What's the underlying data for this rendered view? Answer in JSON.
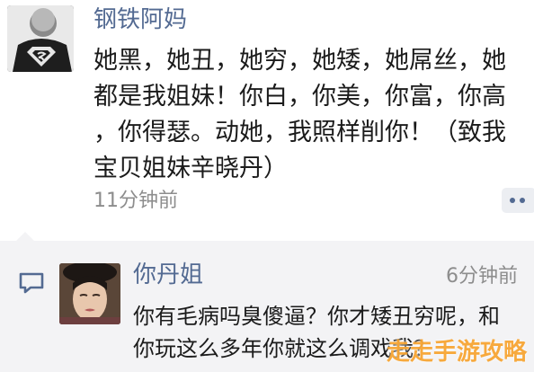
{
  "post": {
    "author": "钢铁阿妈",
    "avatar_icon": "superman-shirt-avatar-icon",
    "text_lines": [
      "她黑，她丑，她穷，她矮，她屌丝，她",
      "都是我姐妹！你白，你美，你富，你高",
      "，你得瑟。动她，我照样削你！（致我",
      "宝贝姐妹辛晓丹）"
    ],
    "time": "11分钟前",
    "more_icon": "ellipsis-comment-icon"
  },
  "comment": {
    "icon": "comment-bubble-icon",
    "avatar_icon": "woman-crying-avatar-icon",
    "author": "你丹姐",
    "time": "6分钟前",
    "text_lines": [
      "你有毛病吗臭傻逼？你才矮丑穷呢，和",
      "你玩这么多年你就这么调戏我？"
    ]
  },
  "watermark": "走走手游攻略",
  "colors": {
    "name": "#536a92",
    "text": "#1b1b1b",
    "muted": "#8d8d8d",
    "comments_bg": "#f3f3f5",
    "watermark": "#f6a028"
  }
}
